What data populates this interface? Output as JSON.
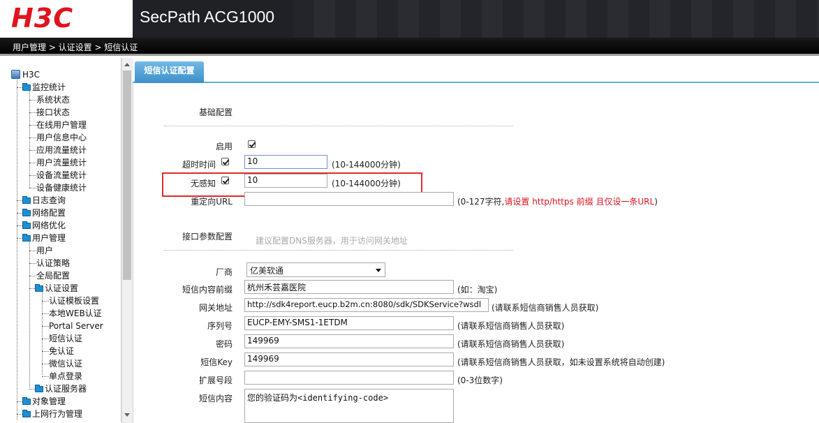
{
  "header": {
    "logo": "H3C",
    "product": "SecPath ACG1000"
  },
  "breadcrumb": "用户管理 > 认证设置 > 短信认证",
  "sidebar": {
    "root": "H3C",
    "items": [
      {
        "label": "监控统计",
        "type": "folder"
      },
      {
        "label": "系统状态",
        "type": "leaf"
      },
      {
        "label": "接口状态",
        "type": "leaf"
      },
      {
        "label": "在线用户管理",
        "type": "leaf"
      },
      {
        "label": "用户信息中心",
        "type": "leaf"
      },
      {
        "label": "应用流量统计",
        "type": "leaf"
      },
      {
        "label": "用户流量统计",
        "type": "leaf"
      },
      {
        "label": "设备流量统计",
        "type": "leaf"
      },
      {
        "label": "设备健康统计",
        "type": "leaf"
      },
      {
        "label": "日志查询",
        "type": "folder"
      },
      {
        "label": "网络配置",
        "type": "folder"
      },
      {
        "label": "网络优化",
        "type": "folder"
      },
      {
        "label": "用户管理",
        "type": "folder"
      },
      {
        "label": "用户",
        "type": "leaf"
      },
      {
        "label": "认证策略",
        "type": "leaf"
      },
      {
        "label": "全局配置",
        "type": "leaf"
      },
      {
        "label": "认证设置",
        "type": "folder"
      },
      {
        "label": "认证模板设置",
        "type": "leaf"
      },
      {
        "label": "本地WEB认证",
        "type": "leaf"
      },
      {
        "label": "Portal Server",
        "type": "leaf"
      },
      {
        "label": "短信认证",
        "type": "leaf"
      },
      {
        "label": "免认证",
        "type": "leaf"
      },
      {
        "label": "微信认证",
        "type": "leaf"
      },
      {
        "label": "单点登录",
        "type": "leaf"
      },
      {
        "label": "认证服务器",
        "type": "folder"
      },
      {
        "label": "对象管理",
        "type": "folder"
      },
      {
        "label": "上网行为管理",
        "type": "folder"
      }
    ]
  },
  "tab": "短信认证配置",
  "basic": {
    "title": "基础配置",
    "enable_label": "启用",
    "timeout_label": "超时时间",
    "timeout_value": "10",
    "timeout_hint": "(10-144000分钟)",
    "nosense_label": "无感知",
    "nosense_value": "10",
    "nosense_hint": "(10-144000分钟)",
    "redirect_label": "重定向URL",
    "redirect_value": "",
    "redirect_hint_prefix": "(0-127字符,",
    "redirect_hint_red": "请设置 http/https 前缀 且仅设一条URL",
    "redirect_hint_suffix": ")"
  },
  "interface": {
    "title": "接口参数配置",
    "hint": "建议配置DNS服务器，用于访问网关地址",
    "vendor_label": "厂商",
    "vendor_value": "亿美软通",
    "prefix_label": "短信内容前缀",
    "prefix_value": "杭州禾芸嘉医院",
    "prefix_hint": "(如：淘宝)",
    "gateway_label": "网关地址",
    "gateway_value": "http://sdk4report.eucp.b2m.cn:8080/sdk/SDKService?wsdl",
    "gateway_hint": "(请联系短信商销售人员获取)",
    "serial_label": "序列号",
    "serial_value": "EUCP-EMY-SMS1-1ETDM",
    "serial_hint": "(请联系短信商销售人员获取)",
    "password_label": "密码",
    "password_value": "149969",
    "password_hint": "(请联系短信商销售人员获取)",
    "smskey_label": "短信Key",
    "smskey_value": "149969",
    "smskey_hint": "(请联系短信商销售人员获取，如未设置系统将自动创建)",
    "ext_label": "扩展号段",
    "ext_value": "",
    "ext_hint": "(0-3位数字)",
    "content_label": "短信内容",
    "content_value": "您的验证码为<identifying-code>"
  }
}
